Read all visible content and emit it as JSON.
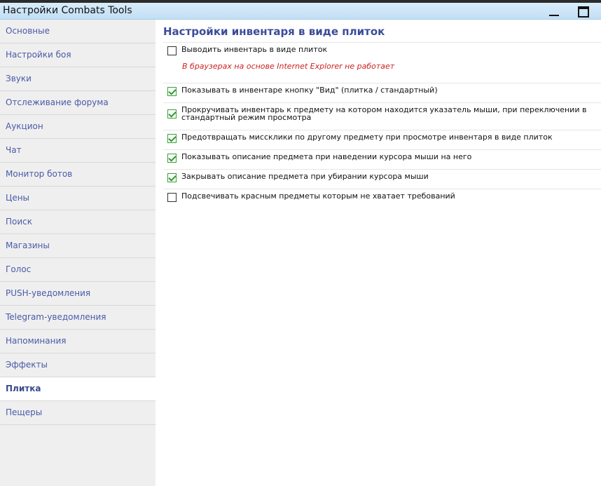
{
  "window": {
    "title": "Настройки Combats Tools"
  },
  "sidebar": {
    "items": [
      {
        "label": "Основные",
        "active": false
      },
      {
        "label": "Настройки боя",
        "active": false
      },
      {
        "label": "Звуки",
        "active": false
      },
      {
        "label": "Отслеживание форума",
        "active": false
      },
      {
        "label": "Аукцион",
        "active": false
      },
      {
        "label": "Чат",
        "active": false
      },
      {
        "label": "Монитор ботов",
        "active": false
      },
      {
        "label": "Цены",
        "active": false
      },
      {
        "label": "Поиск",
        "active": false
      },
      {
        "label": "Магазины",
        "active": false
      },
      {
        "label": "Голос",
        "active": false
      },
      {
        "label": "PUSH-уведомления",
        "active": false
      },
      {
        "label": "Telegram-уведомления",
        "active": false
      },
      {
        "label": "Напоминания",
        "active": false
      },
      {
        "label": "Эффекты",
        "active": false
      },
      {
        "label": "Плитка",
        "active": true
      },
      {
        "label": "Пещеры",
        "active": false
      }
    ]
  },
  "main": {
    "heading": "Настройки инвентаря в виде плиток",
    "note": "В браузерах на основе Internet Explorer не работает",
    "options": [
      {
        "label": "Выводить инвентарь в виде плиток",
        "checked": false
      },
      {
        "label": "Показывать в инвентаре кнопку \"Вид\" (плитка / стандартный)",
        "checked": true
      },
      {
        "label": "Прокручивать инвентарь к предмету на котором находится указатель мыши, при переключении в стандартный режим просмотра",
        "checked": true
      },
      {
        "label": "Предотвращать миссклики по другому предмету при просмотре инвентаря в виде плиток",
        "checked": true
      },
      {
        "label": "Показывать описание предмета при наведении курсора мыши на него",
        "checked": true
      },
      {
        "label": "Закрывать описание предмета при убирании курсора мыши",
        "checked": true
      },
      {
        "label": "Подсвечивать красным предметы которым не хватает требований",
        "checked": false
      }
    ]
  }
}
